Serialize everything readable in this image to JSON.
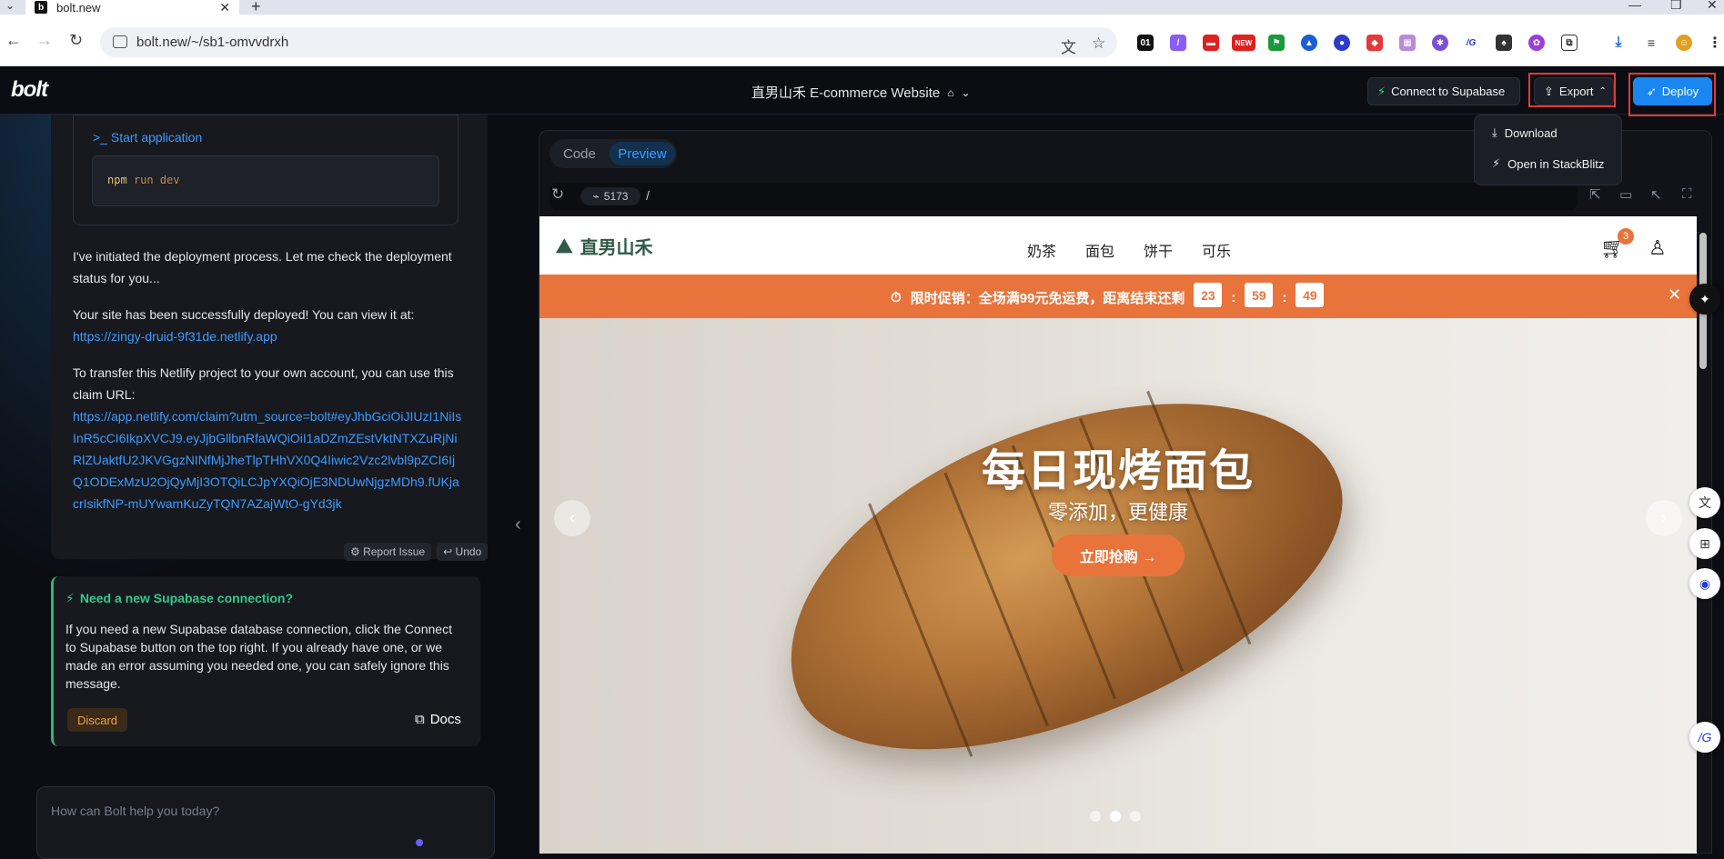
{
  "browser": {
    "tab_title": "bolt.new",
    "tab_favicon": "b",
    "url": "bolt.new/~/sb1-omvvdrxh",
    "extension_labels": [
      "01",
      "NEW",
      "/G"
    ]
  },
  "header": {
    "logo": "bolt",
    "project_title": "直男山禾 E-commerce Website",
    "connect_supabase": "Connect to Supabase",
    "export": "Export",
    "deploy": "Deploy"
  },
  "export_menu": {
    "items": [
      {
        "label": "Download",
        "icon": "download-icon"
      },
      {
        "label": "Open in StackBlitz",
        "icon": "bolt-icon"
      }
    ]
  },
  "chat": {
    "start_application": "Start application",
    "command_kw": "npm",
    "command_rest": "run dev",
    "msg1": "I've initiated the deployment process. Let me check the deployment status for you...",
    "msg2": "Your site has been successfully deployed! You can view it at:",
    "site_link": "https://zingy-druid-9f31de.netlify.app",
    "msg3": "To transfer this Netlify project to your own account, you can use  this claim URL:",
    "claim_link": "https://app.netlify.com/claim?utm_source=bolt#eyJhbGciOiJIUzI1NiIsInR5cCI6IkpXVCJ9.eyJjbGllbnRfaWQiOiI1aDZmZEstVktNTXZuRjNiRlZUaktfU2JKVGgzNINfMjJheTlpTHhVX0Q4Iiwic2Vzc2lvbl9pZCI6IjQ1ODExMzU2OjQyMjI3OTQiLCJpYXQiOjE3NDUwNjgzMDh9.fUKjacrIsikfNP-mUYwamKuZyTQN7AZajWtO-gYd3jk",
    "report_issue": "Report Issue",
    "undo": "Undo",
    "supabase_title": "Need a new Supabase connection?",
    "supabase_body": "If you need a new Supabase database connection, click the Connect to Supabase button on the top right. If you already have one, or we made an error assuming you needed one, you can safely ignore this message.",
    "discard": "Discard",
    "docs": "Docs",
    "prompt_placeholder": "How can Bolt help you today?"
  },
  "preview": {
    "tab_code": "Code",
    "tab_preview": "Preview",
    "port": "5173",
    "path": "/"
  },
  "site": {
    "brand": "直男山禾",
    "nav": [
      "奶茶",
      "面包",
      "饼干",
      "可乐"
    ],
    "cart_count": "3",
    "promo_text": "限时促销：全场满99元免运费，距离结束还剩",
    "countdown": {
      "h": "23",
      "m": "59",
      "s": "49"
    },
    "hero_title": "每日现烤面包",
    "hero_subtitle": "零添加，更健康",
    "hero_cta": "立即抢购 →",
    "slides_total": 3,
    "slide_active": 2,
    "accent": "#e8743b",
    "brand_color": "#2f5a48"
  }
}
